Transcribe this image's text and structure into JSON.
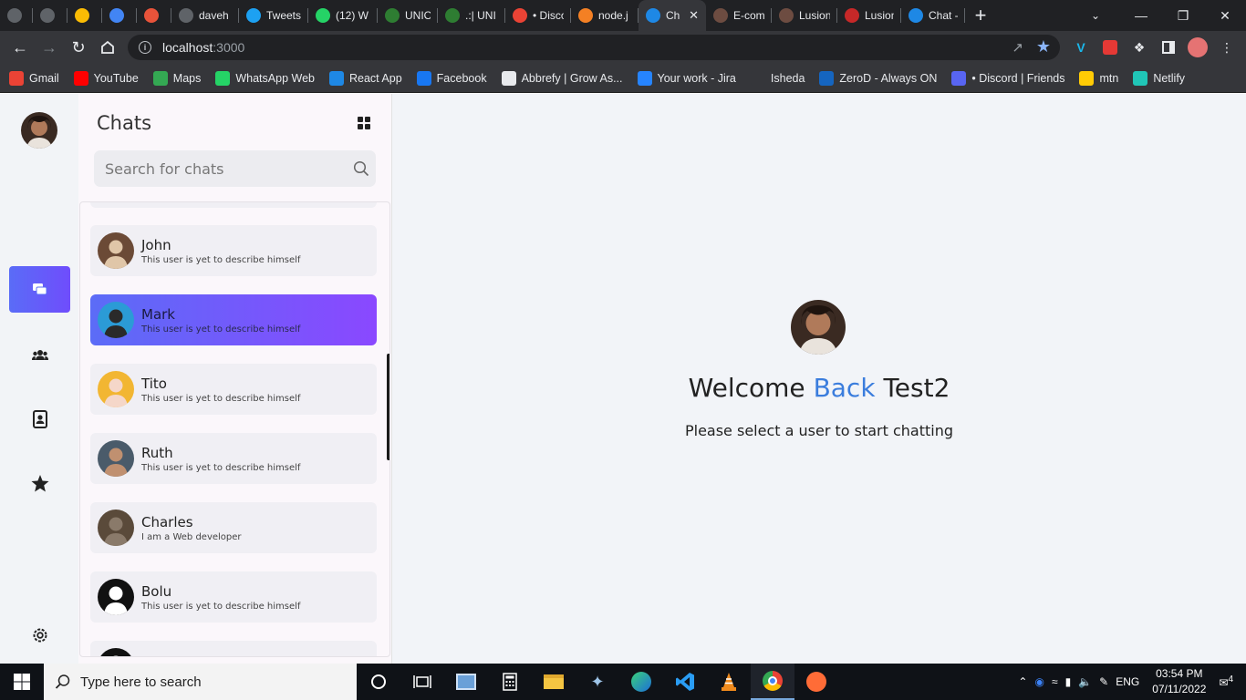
{
  "browser": {
    "tabs": [
      {
        "title": "",
        "color": "#5f6368"
      },
      {
        "title": "",
        "color": "#5f6368"
      },
      {
        "title": "",
        "color": "#fbbc04"
      },
      {
        "title": "",
        "color": "#4285f4"
      },
      {
        "title": "",
        "color": "#e8533a"
      },
      {
        "title": "daveh",
        "color": "#5f6368"
      },
      {
        "title": "Tweets",
        "color": "#1da1f2"
      },
      {
        "title": "(12) W",
        "color": "#25d366"
      },
      {
        "title": "UNIOS",
        "color": "#2e7d32"
      },
      {
        "title": ".:| UNI",
        "color": "#2e7d32"
      },
      {
        "title": "• Disco",
        "color": "#ea4335"
      },
      {
        "title": "node.j",
        "color": "#f48024"
      },
      {
        "title": "Ch",
        "color": "#1e88e5",
        "active": true
      },
      {
        "title": "E-com",
        "color": "#6d4c41"
      },
      {
        "title": "Lusion",
        "color": "#6d4c41"
      },
      {
        "title": "Lusion",
        "color": "#c62828"
      },
      {
        "title": "Chat -",
        "color": "#1e88e5"
      }
    ],
    "url_host": "localhost",
    "url_port": ":3000"
  },
  "bookmarks": [
    {
      "label": "Gmail",
      "color": "#ea4335"
    },
    {
      "label": "YouTube",
      "color": "#ff0000"
    },
    {
      "label": "Maps",
      "color": "#34a853"
    },
    {
      "label": "WhatsApp Web",
      "color": "#25d366"
    },
    {
      "label": "React App",
      "color": "#1e88e5"
    },
    {
      "label": "Facebook",
      "color": "#1877f2"
    },
    {
      "label": "Abbrefy | Grow As...",
      "color": "#e8eaed"
    },
    {
      "label": "Your work - Jira",
      "color": "#2684ff"
    },
    {
      "label": "Isheda",
      "color": "#35363a"
    },
    {
      "label": "ZeroD - Always ON",
      "color": "#1565c0"
    },
    {
      "label": "• Discord | Friends",
      "color": "#5865f2"
    },
    {
      "label": "mtn",
      "color": "#ffcb05"
    },
    {
      "label": "Netlify",
      "color": "#20c6b7"
    }
  ],
  "chats": {
    "title": "Chats",
    "search_placeholder": "Search for chats",
    "items": [
      {
        "name": "John",
        "bio": "This user is yet to describe himself",
        "active": false
      },
      {
        "name": "Mark",
        "bio": "This user is yet to describe himself",
        "active": true
      },
      {
        "name": "Tito",
        "bio": "This user is yet to describe himself",
        "active": false
      },
      {
        "name": "Ruth",
        "bio": "This user is yet to describe himself",
        "active": false
      },
      {
        "name": "Charles",
        "bio": "I am a Web developer",
        "active": false
      },
      {
        "name": "Bolu",
        "bio": "This user is yet to describe himself",
        "active": false
      }
    ]
  },
  "main": {
    "welcome_prefix": "Welcome",
    "welcome_accent": "Back",
    "welcome_name": "Test2",
    "subtitle": "Please select a user to start chatting",
    "accent_color": "#3b7ddd"
  },
  "taskbar": {
    "search_placeholder": "Type here to search",
    "language": "ENG",
    "time": "03:54 PM",
    "date": "07/11/2022",
    "notifications": "4"
  }
}
